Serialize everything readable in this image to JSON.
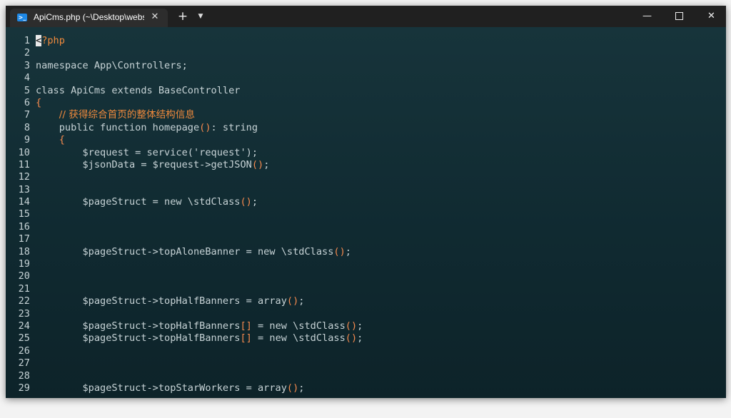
{
  "tab": {
    "title": "ApiCms.php (~\\Desktop\\webs",
    "close": "✕",
    "icon": "powershell-icon"
  },
  "titlebar": {
    "new_tab": "+",
    "dropdown": "⌄",
    "minimize": "—",
    "close": "✕"
  },
  "code_lines": [
    {
      "n": "1",
      "parts": [
        {
          "t": "<",
          "c": "cursor"
        },
        {
          "t": "?php",
          "c": "tag"
        }
      ]
    },
    {
      "n": "2",
      "parts": []
    },
    {
      "n": "3",
      "parts": [
        {
          "t": "namespace App\\Controllers;",
          "c": "kw"
        }
      ]
    },
    {
      "n": "4",
      "parts": []
    },
    {
      "n": "5",
      "parts": [
        {
          "t": "class ApiCms extends BaseController",
          "c": "kw"
        }
      ]
    },
    {
      "n": "6",
      "parts": [
        {
          "t": "{",
          "c": "paren"
        }
      ]
    },
    {
      "n": "7",
      "parts": [
        {
          "t": "    ",
          "c": "kw"
        },
        {
          "t": "// 获得综合首页的整体结构信息",
          "c": "cmt"
        }
      ]
    },
    {
      "n": "8",
      "parts": [
        {
          "t": "    public function homepage",
          "c": "kw"
        },
        {
          "t": "()",
          "c": "paren"
        },
        {
          "t": ": string",
          "c": "kw"
        }
      ]
    },
    {
      "n": "9",
      "parts": [
        {
          "t": "    ",
          "c": "kw"
        },
        {
          "t": "{",
          "c": "paren"
        }
      ]
    },
    {
      "n": "10",
      "parts": [
        {
          "t": "        $request = service('request');",
          "c": "kw"
        }
      ]
    },
    {
      "n": "11",
      "parts": [
        {
          "t": "        $jsonData = $request->getJSON",
          "c": "kw"
        },
        {
          "t": "()",
          "c": "paren"
        },
        {
          "t": ";",
          "c": "kw"
        }
      ]
    },
    {
      "n": "12",
      "parts": []
    },
    {
      "n": "13",
      "parts": []
    },
    {
      "n": "14",
      "parts": [
        {
          "t": "        $pageStruct = new \\stdClass",
          "c": "kw"
        },
        {
          "t": "()",
          "c": "paren"
        },
        {
          "t": ";",
          "c": "kw"
        }
      ]
    },
    {
      "n": "15",
      "parts": []
    },
    {
      "n": "16",
      "parts": []
    },
    {
      "n": "17",
      "parts": []
    },
    {
      "n": "18",
      "parts": [
        {
          "t": "        $pageStruct->topAloneBanner = new \\stdClass",
          "c": "kw"
        },
        {
          "t": "()",
          "c": "paren"
        },
        {
          "t": ";",
          "c": "kw"
        }
      ]
    },
    {
      "n": "19",
      "parts": []
    },
    {
      "n": "20",
      "parts": []
    },
    {
      "n": "21",
      "parts": []
    },
    {
      "n": "22",
      "parts": [
        {
          "t": "        $pageStruct->topHalfBanners = array",
          "c": "kw"
        },
        {
          "t": "()",
          "c": "paren"
        },
        {
          "t": ";",
          "c": "kw"
        }
      ]
    },
    {
      "n": "23",
      "parts": []
    },
    {
      "n": "24",
      "parts": [
        {
          "t": "        $pageStruct->topHalfBanners",
          "c": "kw"
        },
        {
          "t": "[]",
          "c": "paren"
        },
        {
          "t": " = new \\stdClass",
          "c": "kw"
        },
        {
          "t": "()",
          "c": "paren"
        },
        {
          "t": ";",
          "c": "kw"
        }
      ]
    },
    {
      "n": "25",
      "parts": [
        {
          "t": "        $pageStruct->topHalfBanners",
          "c": "kw"
        },
        {
          "t": "[]",
          "c": "paren"
        },
        {
          "t": " = new \\stdClass",
          "c": "kw"
        },
        {
          "t": "()",
          "c": "paren"
        },
        {
          "t": ";",
          "c": "kw"
        }
      ]
    },
    {
      "n": "26",
      "parts": []
    },
    {
      "n": "27",
      "parts": []
    },
    {
      "n": "28",
      "parts": []
    },
    {
      "n": "29",
      "parts": [
        {
          "t": "        $pageStruct->topStarWorkers = array",
          "c": "kw"
        },
        {
          "t": "()",
          "c": "paren"
        },
        {
          "t": ";",
          "c": "kw"
        }
      ]
    }
  ]
}
